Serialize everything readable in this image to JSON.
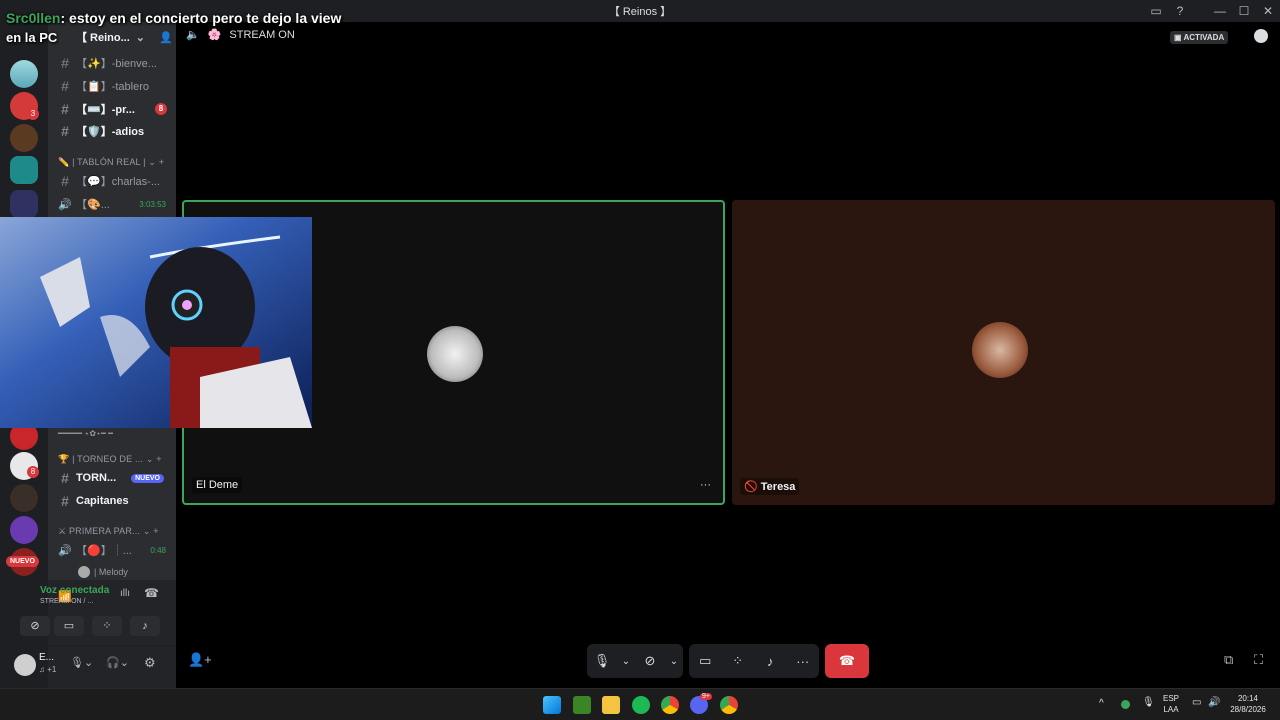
{
  "overlay_chat": {
    "user": "Src0llen",
    "message": ": estoy en el concierto pero te dejo la view",
    "message2": "en la PC"
  },
  "window": {
    "title": "【 Reinos 】"
  },
  "guild": {
    "name": "【 Reino..."
  },
  "channels": [
    {
      "label": "【✨】-bienve...",
      "bold": false
    },
    {
      "label": "【📋】-tablero",
      "bold": false
    },
    {
      "label": "【⌨️】-pr...",
      "bold": true,
      "badge": "8"
    },
    {
      "label": "【🛡️】-adios",
      "bold": true
    }
  ],
  "categories": {
    "tablon": "| TABLÓN REAL |",
    "torneo": "| TORNEO DE ...",
    "primera": "PRIMERA PAR..."
  },
  "channels2": [
    {
      "label": "【💬】charlas-..."
    },
    {
      "label": "【🎨...",
      "timer": "3:03:53"
    }
  ],
  "channels3": [
    {
      "label": "━━━━━ ⋆✿⋆━ ━",
      "bold": false
    },
    {
      "label": "TORN...",
      "bold": true,
      "badge": "NUEVO"
    },
    {
      "label": "Capitanes",
      "bold": true
    }
  ],
  "voice_channel": {
    "label": "【🔴】┊...",
    "timer": "0:48",
    "member": "| Melody"
  },
  "voice_panel": {
    "status": "Voz conectada",
    "detail": "STREAM ON / ...",
    "new_badge": "NUEVO"
  },
  "user_panel": {
    "name": "E...",
    "sub": "♫ +1"
  },
  "stage": {
    "channel_title": "STREAM ON",
    "activated": "ACTIVADA",
    "tiles": [
      {
        "name": "El Deme"
      },
      {
        "name": "Teresa"
      }
    ]
  },
  "server_badges": [
    "3",
    "8"
  ],
  "taskbar": {
    "lang1": "ESP",
    "lang2": "LAA",
    "time": "20:14",
    "date": "28/8/2026",
    "discord_badge": "9+"
  },
  "colors": {
    "accent_green": "#3ba55c",
    "danger": "#da373c",
    "blurple": "#5865f2",
    "stage_bg": "#000000"
  }
}
